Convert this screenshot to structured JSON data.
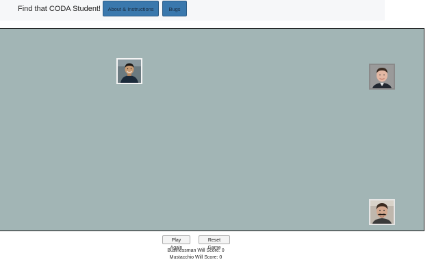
{
  "header": {
    "title": "Find that CODA Student!",
    "nav": {
      "about_label": "About & Instructions",
      "bugs_label": "Bugs"
    }
  },
  "board": {
    "background_color": "#a2b5b5",
    "avatars": [
      {
        "name": "student-photo-smiling-man-icon"
      },
      {
        "name": "businessman-will-photo-icon"
      },
      {
        "name": "mustacchio-will-photo-icon"
      }
    ]
  },
  "controls": {
    "play_again_label": "Play Again",
    "reset_label": "Reset Game"
  },
  "scores": {
    "businessman_line": "Businessman Will Score: 0",
    "mustacchio_line": "Mustacchio Will Score: 0"
  },
  "colors": {
    "nav_button": "#3a78ad",
    "topbar": "#f6f7f9"
  }
}
